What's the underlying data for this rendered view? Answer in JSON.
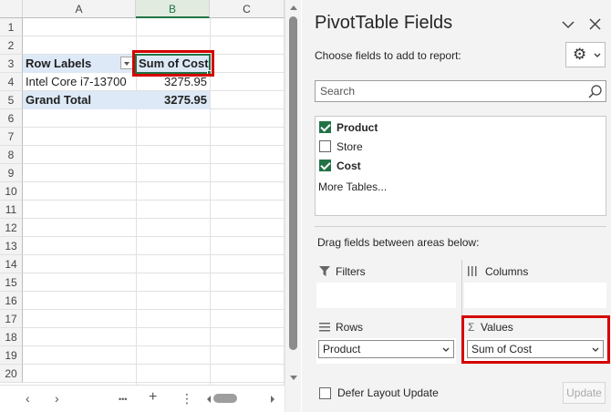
{
  "sheet": {
    "columns": [
      "A",
      "B",
      "C"
    ],
    "rows": [
      "1",
      "2",
      "3",
      "4",
      "5",
      "6",
      "7",
      "8",
      "9",
      "10",
      "11",
      "12",
      "13",
      "14",
      "15",
      "16",
      "17",
      "18",
      "19",
      "20"
    ],
    "pivot": {
      "row_labels": "Row Labels",
      "value_header": "Sum of Cost",
      "item_label": "Intel Core i7-13700",
      "item_value": "3275.95",
      "total_label": "Grand Total",
      "total_value": "3275.95"
    },
    "selected_cell": "B3"
  },
  "sheet_bar": {
    "prev_icon": "‹",
    "next_icon": "›",
    "more_icon": "•••",
    "add_icon": "+",
    "options_icon": "⋮"
  },
  "pane": {
    "title": "PivotTable Fields",
    "choose_label": "Choose fields to add to report:",
    "search_placeholder": "Search",
    "fields": [
      {
        "name": "Product",
        "checked": true
      },
      {
        "name": "Store",
        "checked": false
      },
      {
        "name": "Cost",
        "checked": true
      }
    ],
    "more_tables": "More Tables...",
    "drag_label": "Drag fields between areas below:",
    "areas": {
      "filters": "Filters",
      "columns": "Columns",
      "rows": "Rows",
      "values": "Values",
      "rows_item": "Product",
      "values_item": "Sum of Cost"
    },
    "defer_label": "Defer Layout Update",
    "update_button": "Update"
  },
  "highlight_color": "#d40000",
  "accent_color": "#217346"
}
